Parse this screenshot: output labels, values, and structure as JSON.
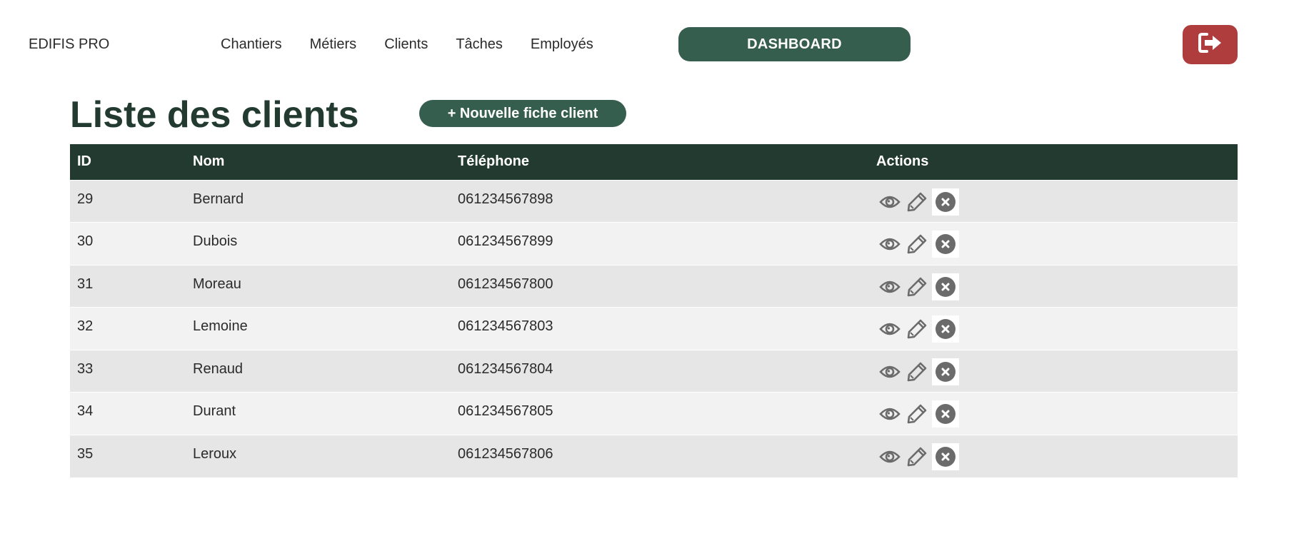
{
  "header": {
    "brand": "EDIFIS PRO",
    "nav": [
      "Chantiers",
      "Métiers",
      "Clients",
      "Tâches",
      "Employés"
    ],
    "dashboard_label": "DASHBOARD",
    "logout_icon": "sign-out-icon"
  },
  "main": {
    "title": "Liste des clients",
    "new_client_label": "+ Nouvelle fiche client",
    "table": {
      "columns": [
        "ID",
        "Nom",
        "Téléphone",
        "Actions"
      ],
      "rows": [
        {
          "id": "29",
          "nom": "Bernard",
          "tel": "061234567898"
        },
        {
          "id": "30",
          "nom": "Dubois",
          "tel": "061234567899"
        },
        {
          "id": "31",
          "nom": "Moreau",
          "tel": "061234567800"
        },
        {
          "id": "32",
          "nom": "Lemoine",
          "tel": "061234567803"
        },
        {
          "id": "33",
          "nom": "Renaud",
          "tel": "061234567804"
        },
        {
          "id": "34",
          "nom": "Durant",
          "tel": "061234567805"
        },
        {
          "id": "35",
          "nom": "Leroux",
          "tel": "061234567806"
        }
      ],
      "row_actions": [
        "eye-icon",
        "pencil-icon",
        "close-circle-icon"
      ]
    }
  },
  "colors": {
    "primary": "#365e4f",
    "header_dark": "#233a31",
    "danger": "#b03d3d",
    "icon_gray": "#6b6b6b",
    "row_odd": "#e6e6e6",
    "row_even": "#f2f2f2"
  }
}
